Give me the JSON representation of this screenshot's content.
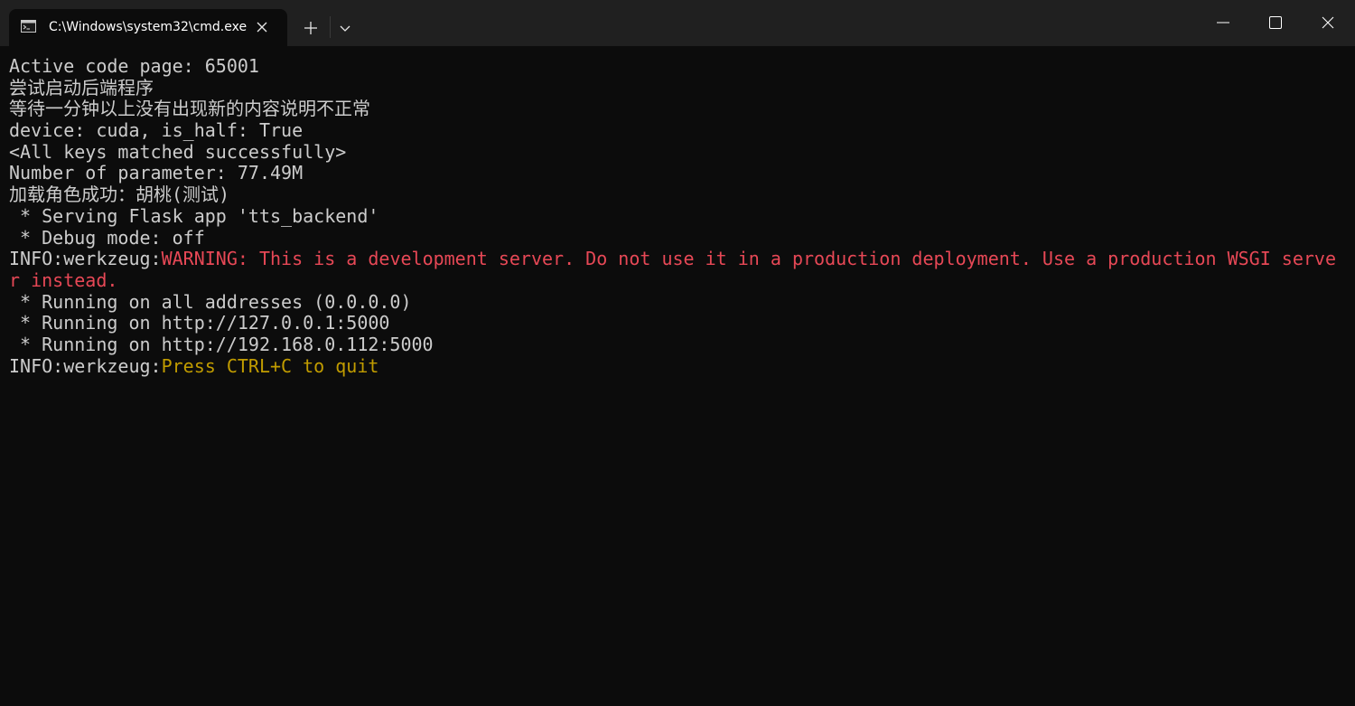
{
  "colors": {
    "titlebar": "#202020",
    "console_bg": "#0c0c0c",
    "console_text": "#cccccc",
    "warning_red": "#e74856",
    "notice_yellow": "#c19c00"
  },
  "titlebar": {
    "tab": {
      "icon": "cmd-icon",
      "title": "C:\\Windows\\system32\\cmd.exe",
      "close_icon": "close-icon"
    },
    "new_tab_icon": "plus-icon",
    "dropdown_icon": "chevron-down-icon",
    "window_controls": [
      "minimize-icon",
      "maximize-icon",
      "close-icon"
    ]
  },
  "console": {
    "lines": [
      "Active code page: 65001",
      "尝试启动后端程序",
      "等待一分钟以上没有出现新的内容说明不正常",
      "device: cuda, is_half: True",
      "<All keys matched successfully>",
      "Number of parameter: 77.49M",
      "加载角色成功：胡桃(测试)",
      " * Serving Flask app 'tts_backend'",
      " * Debug mode: off"
    ],
    "warning_line": {
      "prefix": "INFO:werkzeug:",
      "message": "WARNING: This is a development server. Do not use it in a production deployment. Use a production WSGI server instead."
    },
    "running_lines": [
      " * Running on all addresses (0.0.0.0)",
      " * Running on http://127.0.0.1:5000",
      " * Running on http://192.168.0.112:5000"
    ],
    "quit_line": {
      "prefix": "INFO:werkzeug:",
      "message": "Press CTRL+C to quit"
    }
  }
}
